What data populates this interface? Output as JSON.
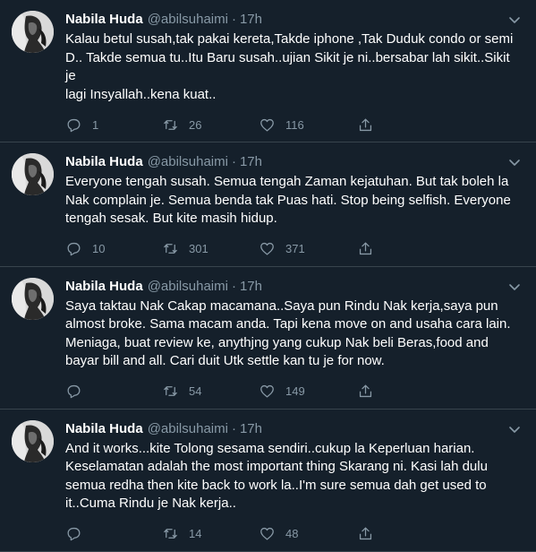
{
  "tweets": [
    {
      "name": "Nabila Huda",
      "handle": "@abilsuhaimi",
      "separator": "·",
      "time": "17h",
      "lines": [
        "Kalau betul susah,tak pakai kereta,Takde iphone ,Tak Duduk condo or semi",
        "D.. Takde semua tu..Itu Baru susah..ujian Sikit je ni..bersabar lah sikit..Sikit je",
        "lagi Insyallah..kena kuat.."
      ],
      "replies": "1",
      "retweets": "26",
      "likes": "116"
    },
    {
      "name": "Nabila Huda",
      "handle": "@abilsuhaimi",
      "separator": "·",
      "time": "17h",
      "lines": [
        "Everyone tengah susah. Semua tengah Zaman kejatuhan. But tak boleh la",
        "Nak complain je. Semua benda tak Puas hati. Stop being selfish. Everyone",
        "tengah sesak. But kite masih hidup."
      ],
      "replies": "10",
      "retweets": "301",
      "likes": "371"
    },
    {
      "name": "Nabila Huda",
      "handle": "@abilsuhaimi",
      "separator": "·",
      "time": "17h",
      "lines": [
        "Saya taktau Nak Cakap macamana..Saya pun Rindu Nak kerja,saya pun",
        "almost broke. Sama macam anda. Tapi kena move on and usaha cara lain.",
        "Meniaga, buat review ke, anythjng yang cukup Nak beli Beras,food and",
        "bayar bill and all. Cari duit Utk settle kan tu je for now."
      ],
      "replies": "",
      "retweets": "54",
      "likes": "149"
    },
    {
      "name": "Nabila Huda",
      "handle": "@abilsuhaimi",
      "separator": "·",
      "time": "17h",
      "lines": [
        "And it works...kite Tolong sesama sendiri..cukup la Keperluan harian.",
        "Keselamatan adalah the most important thing Skarang ni. Kasi lah dulu",
        "semua redha then kite back to work la..I'm sure semua dah get used to",
        "it..Cuma Rindu je Nak kerja.."
      ],
      "replies": "",
      "retweets": "14",
      "likes": "48"
    }
  ],
  "icons": {
    "reply": "reply-icon",
    "retweet": "retweet-icon",
    "like": "heart-icon",
    "share": "share-icon",
    "caret": "chevron-down-icon"
  },
  "colors": {
    "background": "#15202b",
    "border": "#38444d",
    "secondary_text": "#8899a6",
    "primary_text": "#ffffff"
  }
}
